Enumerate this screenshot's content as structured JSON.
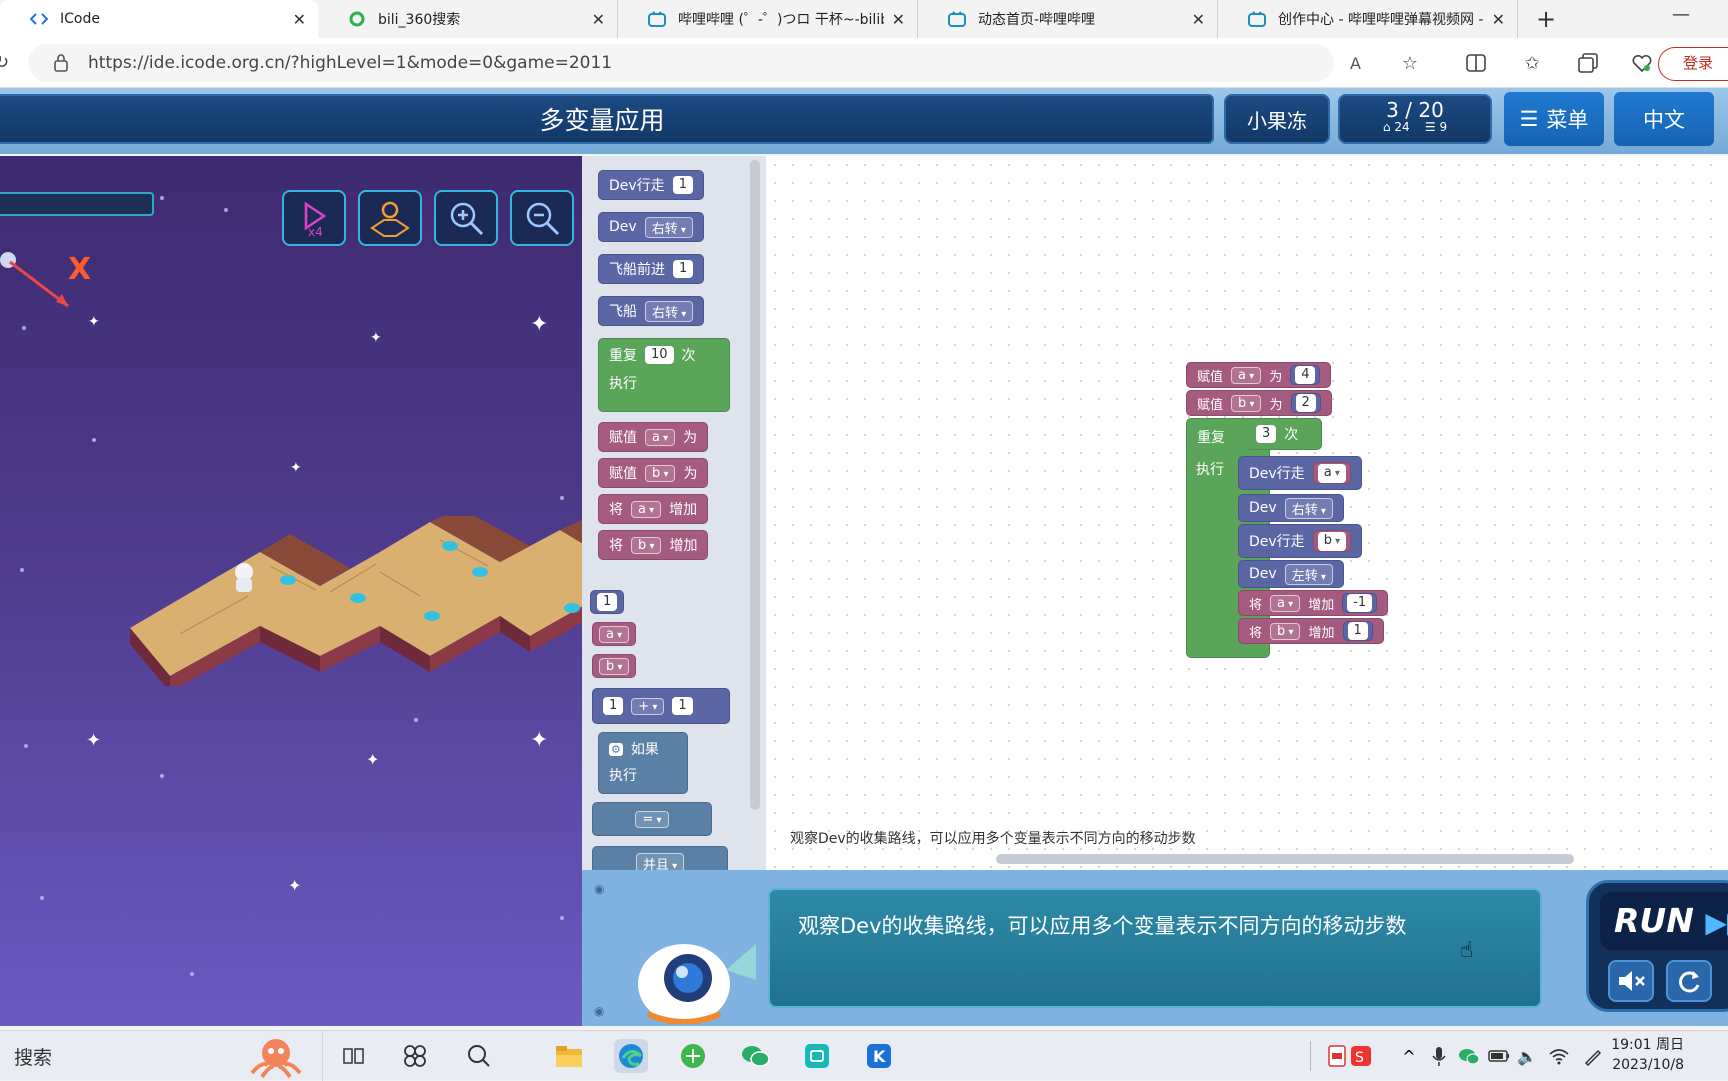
{
  "browser": {
    "tabs": [
      {
        "label": "ICode",
        "icon": "code-icon",
        "active": true
      },
      {
        "label": "bili_360搜索",
        "icon": "search360-icon",
        "active": false
      },
      {
        "label": "哔哩哔哩 (゜-゜)つロ 干杯~-bilib",
        "icon": "bilibili-icon",
        "active": false
      },
      {
        "label": "动态首页-哔哩哔哩",
        "icon": "bilibili-icon",
        "active": false
      },
      {
        "label": "创作中心 - 哔哩哔哩弹幕视频网 -",
        "icon": "bilibili-icon",
        "active": false
      }
    ],
    "new_tab": "+",
    "minimize": "—",
    "url": "https://ide.icode.org.cn/?highLevel=1&mode=0&game=2011",
    "read_aloud": "A",
    "login": "登录"
  },
  "app": {
    "title": "多变量应用",
    "user": "小果冻",
    "level": "3 / 20",
    "stat_a": "24",
    "stat_b": "9",
    "menu": "菜单",
    "language": "中文"
  },
  "game": {
    "axis_label": "X"
  },
  "toolbox": {
    "blocks": [
      {
        "text": "Dev行走",
        "field": "1"
      },
      {
        "text": "Dev",
        "dropdown": "右转"
      },
      {
        "text": "飞船前进",
        "field": "1"
      },
      {
        "text": "飞船",
        "dropdown": "右转"
      },
      {
        "text": "重复",
        "field": "10",
        "suffix": "次",
        "exec": "执行"
      },
      {
        "text": "赋值",
        "dropdown": "a",
        "suffix": "为"
      },
      {
        "text": "赋值",
        "dropdown": "b",
        "suffix": "为"
      },
      {
        "text": "将",
        "dropdown": "a",
        "suffix": "增加"
      },
      {
        "text": "将",
        "dropdown": "b",
        "suffix": "增加"
      },
      {
        "field": "1"
      },
      {
        "dropdown": "a"
      },
      {
        "dropdown": "b"
      },
      {
        "left": "1",
        "op": "+",
        "right": "1"
      },
      {
        "text": "如果",
        "exec": "执行"
      },
      {
        "op": "="
      },
      {
        "op": "并且"
      }
    ]
  },
  "program": {
    "assign_a": {
      "kw": "赋值",
      "var": "a",
      "as": "为",
      "value": "4"
    },
    "assign_b": {
      "kw": "赋值",
      "var": "b",
      "as": "为",
      "value": "2"
    },
    "repeat": {
      "kw": "重复",
      "times": "3",
      "suffix": "次",
      "exec": "执行"
    },
    "body": [
      {
        "kw": "Dev行走",
        "arg": "a"
      },
      {
        "kw": "Dev",
        "arg": "右转"
      },
      {
        "kw": "Dev行走",
        "arg": "b"
      },
      {
        "kw": "Dev",
        "arg": "左转"
      },
      {
        "kw": "将",
        "var": "a",
        "op": "增加",
        "value": "-1"
      },
      {
        "kw": "将",
        "var": "b",
        "op": "增加",
        "value": "1"
      }
    ]
  },
  "workspace_note": "观察Dev的收集路线，可以应用多个变量表示不同方向的移动步数",
  "hint": "观察Dev的收集路线，可以应用多个变量表示不同方向的移动步数",
  "run_label": "RUN",
  "taskbar": {
    "search": "搜索",
    "time": "19:01 周日",
    "date": "2023/10/8"
  },
  "colors": {
    "motion_block": "#5b67a5",
    "variable_block": "#a55b80",
    "loop_block": "#5ba55b",
    "logic_block": "#5b80a5",
    "header": "#123866"
  }
}
